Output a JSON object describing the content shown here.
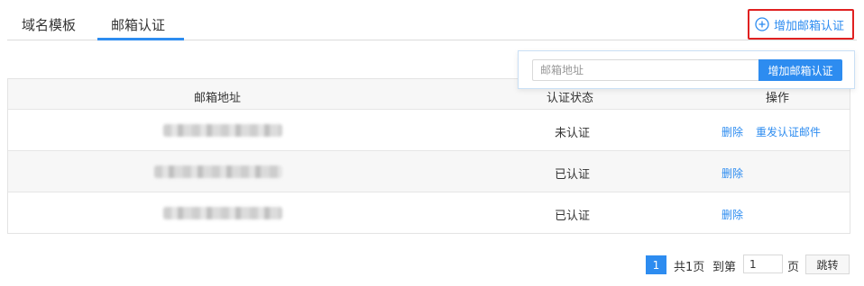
{
  "tabs": [
    {
      "label": "域名模板"
    },
    {
      "label": "邮箱认证",
      "active": true
    }
  ],
  "add_button": {
    "label": "增加邮箱认证",
    "icon": "plus-circle-icon"
  },
  "popover": {
    "input_placeholder": "邮箱地址",
    "input_value": "",
    "button_label": "增加邮箱认证"
  },
  "table": {
    "columns": [
      "邮箱地址",
      "认证状态",
      "操作"
    ],
    "rows": [
      {
        "email": "",
        "status": "未认证",
        "actions": [
          "删除",
          "重发认证邮件"
        ]
      },
      {
        "email": "",
        "status": "已认证",
        "actions": [
          "删除"
        ]
      },
      {
        "email": "",
        "status": "已认证",
        "actions": [
          "删除"
        ]
      }
    ]
  },
  "pagination": {
    "current_page": "1",
    "total_text": "共1页",
    "goto_label": "到第",
    "page_input_value": "1",
    "unit_label": "页",
    "jump_label": "跳转"
  },
  "colors": {
    "accent": "#2d8cf0",
    "highlight_border": "#e02020"
  }
}
